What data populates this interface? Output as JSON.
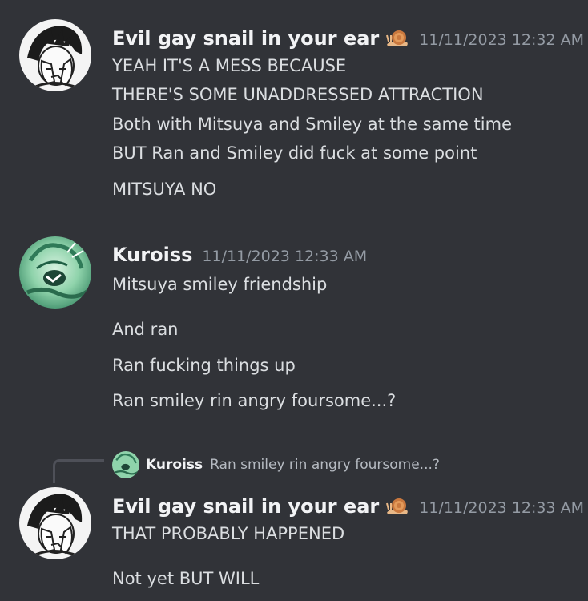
{
  "messages": [
    {
      "username": "Evil gay snail in your ear",
      "badge_icon": "snail-emoji",
      "timestamp": "11/11/2023 12:32 AM",
      "lines": [
        "YEAH IT'S A MESS BECAUSE",
        "THERE'S SOME UNADDRESSED ATTRACTION",
        "Both with Mitsuya and Smiley at the same time",
        "BUT Ran and Smiley did fuck at some point",
        "MITSUYA NO"
      ]
    },
    {
      "username": "Kuroiss",
      "timestamp": "11/11/2023 12:33 AM",
      "lines": [
        "Mitsuya smiley friendship",
        "And ran",
        "Ran fucking things up",
        "Ran smiley rin angry foursome...?"
      ]
    },
    {
      "reply": {
        "username": "Kuroiss",
        "text": "Ran smiley rin angry foursome...?"
      },
      "username": "Evil gay snail in your ear",
      "badge_icon": "snail-emoji",
      "timestamp": "11/11/2023 12:33 AM",
      "lines": [
        "THAT PROBABLY HAPPENED",
        "Not yet BUT WILL"
      ]
    }
  ],
  "colors": {
    "background": "#313338",
    "username": "#f2f3f5",
    "text": "#dbdee1",
    "timestamp": "#949ba4"
  }
}
